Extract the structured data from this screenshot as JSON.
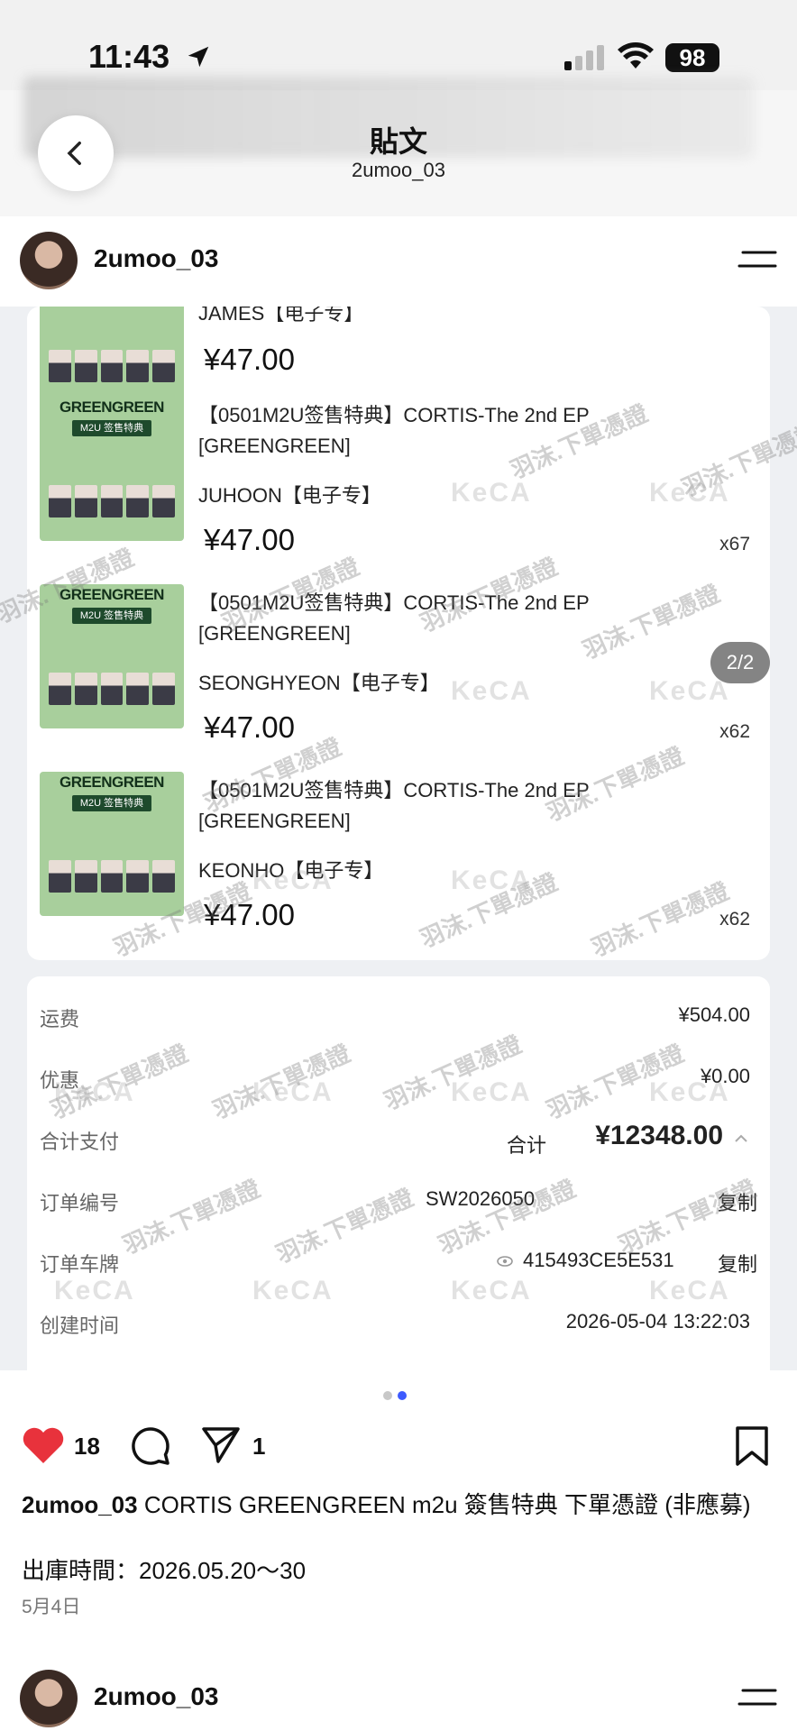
{
  "status": {
    "time": "11:43",
    "battery": "98"
  },
  "header": {
    "title": "貼文",
    "subtitle": "2umoo_03"
  },
  "author": {
    "username": "2umoo_03"
  },
  "post_image": {
    "page_indicator": "2/2",
    "partial_item": {
      "variant": "JAMES【电子专】",
      "price": "¥47.00"
    },
    "thumb_label": "GREENGREEN",
    "thumb_tag": "M2U 签售特典",
    "items": [
      {
        "title": "【0501M2U签售特典】CORTIS-The 2nd EP [GREENGREEN]",
        "variant": "JUHOON【电子专】",
        "price": "¥47.00",
        "qty": "x67"
      },
      {
        "title": "【0501M2U签售特典】CORTIS-The 2nd EP [GREENGREEN]",
        "variant": "SEONGHYEON【电子专】",
        "price": "¥47.00",
        "qty": "x62"
      },
      {
        "title": "【0501M2U签售特典】CORTIS-The 2nd EP [GREENGREEN]",
        "variant": "KEONHO【电子专】",
        "price": "¥47.00",
        "qty": "x62"
      }
    ],
    "summary": {
      "shipping_label": "运费",
      "shipping_value": "¥504.00",
      "discount_label": "优惠",
      "discount_value": "¥0.00",
      "total_label": "合计支付",
      "total_prefix": "合计",
      "total_value": "¥12348.00",
      "order_no_label": "订单编号",
      "order_no_value": "SW2026050",
      "plate_label": "订单车牌",
      "plate_value": "415493CE5E531",
      "copy_label": "复制",
      "created_label": "创建时间",
      "created_value": "2026-05-04 13:22:03"
    },
    "watermark_text": "羽沫.下單憑證",
    "watermark_brand": "KeCA"
  },
  "actions": {
    "likes": "18",
    "shares": "1"
  },
  "caption": {
    "username": "2umoo_03",
    "text": "CORTIS GREENGREEN m2u 簽售特典 下單憑證 (非應募)",
    "line2": "出庫時間：2026.05.20～30",
    "date": "5月4日"
  },
  "next_post": {
    "username": "2umoo_03"
  },
  "colors": {
    "like": "#e8323c",
    "dot_active": "#3d5afe",
    "thumb_green": "#a8cf9c"
  }
}
